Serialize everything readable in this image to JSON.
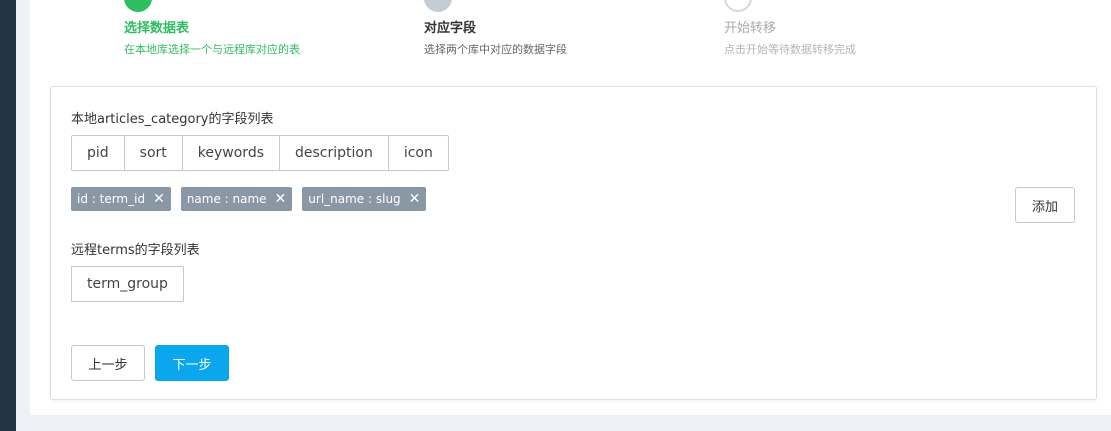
{
  "steps": [
    {
      "title": "选择数据表",
      "desc": "在本地库选择一个与远程库对应的表",
      "state": "done"
    },
    {
      "title": "对应字段",
      "desc": "选择两个库中对应的数据字段",
      "state": "active"
    },
    {
      "title": "开始转移",
      "desc": "点击开始等待数据转移完成",
      "state": "pending"
    }
  ],
  "local_fields": {
    "label": "本地articles_category的字段列表",
    "options": [
      "pid",
      "sort",
      "keywords",
      "description",
      "icon"
    ]
  },
  "mappings": [
    {
      "text": "id : term_id"
    },
    {
      "text": "name : name"
    },
    {
      "text": "url_name : slug"
    }
  ],
  "add_label": "添加",
  "remote_fields": {
    "label": "远程terms的字段列表",
    "options": [
      "term_group"
    ]
  },
  "nav": {
    "prev_label": "上一步",
    "next_label": "下一步"
  },
  "colors": {
    "done": "#2fbd62",
    "primary": "#0aa7ef",
    "tag": "#8a97a5"
  }
}
